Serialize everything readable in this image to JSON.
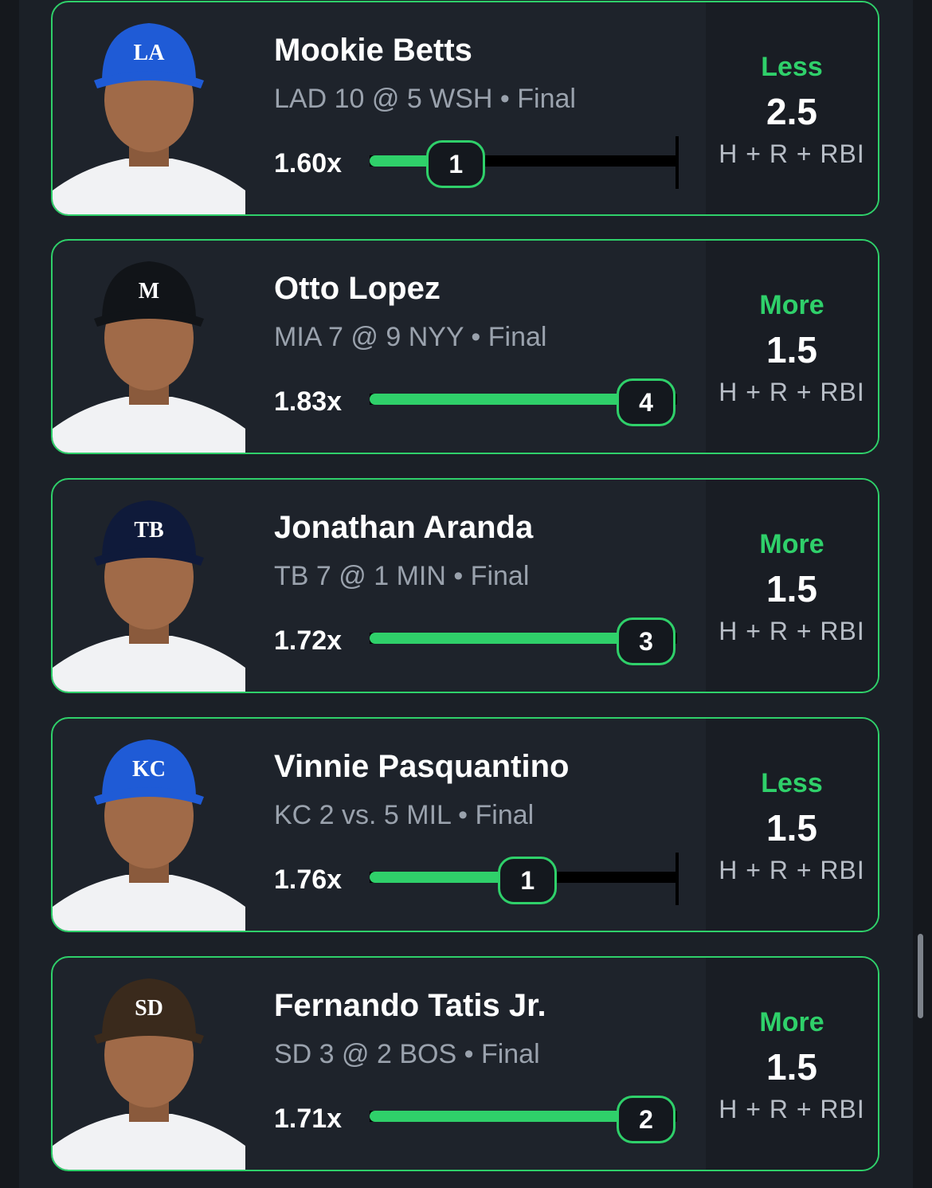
{
  "picks": [
    {
      "name": "Mookie Betts",
      "game": "LAD 10 @ 5 WSH • Final",
      "multiplier": "1.60x",
      "actual": "1",
      "progress": 0.31,
      "direction": "Less",
      "line": "2.5",
      "stat": "H + R + RBI",
      "team_logo": "LA",
      "cap_color": "#1f5bd6"
    },
    {
      "name": "Otto Lopez",
      "game": "MIA 7 @ 9 NYY • Final",
      "multiplier": "1.83x",
      "actual": "4",
      "progress": 1.0,
      "direction": "More",
      "line": "1.5",
      "stat": "H + R + RBI",
      "team_logo": "M",
      "cap_color": "#111418"
    },
    {
      "name": "Jonathan Aranda",
      "game": "TB 7 @ 1 MIN • Final",
      "multiplier": "1.72x",
      "actual": "3",
      "progress": 1.0,
      "direction": "More",
      "line": "1.5",
      "stat": "H + R + RBI",
      "team_logo": "TB",
      "cap_color": "#0f1a3a"
    },
    {
      "name": "Vinnie Pasquantino",
      "game": "KC 2 vs. 5 MIL • Final",
      "multiplier": "1.76x",
      "actual": "1",
      "progress": 0.57,
      "direction": "Less",
      "line": "1.5",
      "stat": "H + R + RBI",
      "team_logo": "KC",
      "cap_color": "#1f5bd6"
    },
    {
      "name": "Fernando Tatis Jr.",
      "game": "SD 3 @ 2 BOS • Final",
      "multiplier": "1.71x",
      "actual": "2",
      "progress": 1.0,
      "direction": "More",
      "line": "1.5",
      "stat": "H + R + RBI",
      "team_logo": "SD",
      "cap_color": "#3a2a1c"
    }
  ],
  "colors": {
    "accent": "#2fd06a",
    "card_bg": "#1e232b",
    "page_bg": "#15181d"
  }
}
